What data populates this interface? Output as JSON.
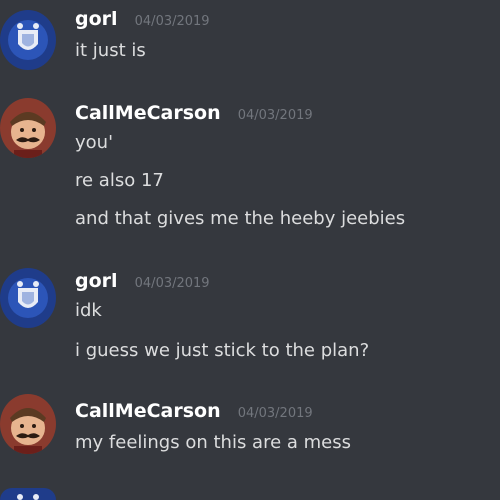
{
  "messages": [
    {
      "username": "gorl",
      "timestamp": "04/03/2019",
      "avatar_icon": "shield-crest-avatar-icon",
      "lines": [
        "it just is"
      ]
    },
    {
      "username": "CallMeCarson",
      "timestamp": "04/03/2019",
      "avatar_icon": "mustache-face-avatar-icon",
      "lines": [
        "you'",
        "re also 17",
        "and that gives me the heeby jeebies"
      ]
    },
    {
      "username": "gorl",
      "timestamp": "04/03/2019",
      "avatar_icon": "shield-crest-avatar-icon",
      "lines": [
        "idk",
        "i guess we just stick to the plan?"
      ]
    },
    {
      "username": "CallMeCarson",
      "timestamp": "04/03/2019",
      "avatar_icon": "mustache-face-avatar-icon",
      "lines": [
        "my feelings on this are a mess"
      ]
    }
  ],
  "colors": {
    "background": "#35383e",
    "username": "#ffffff",
    "timestamp": "#72767d",
    "message_text": "#dcddde",
    "gorl_avatar_bg": "#1f3c8a",
    "carson_avatar_bg": "#8a3b2e"
  }
}
